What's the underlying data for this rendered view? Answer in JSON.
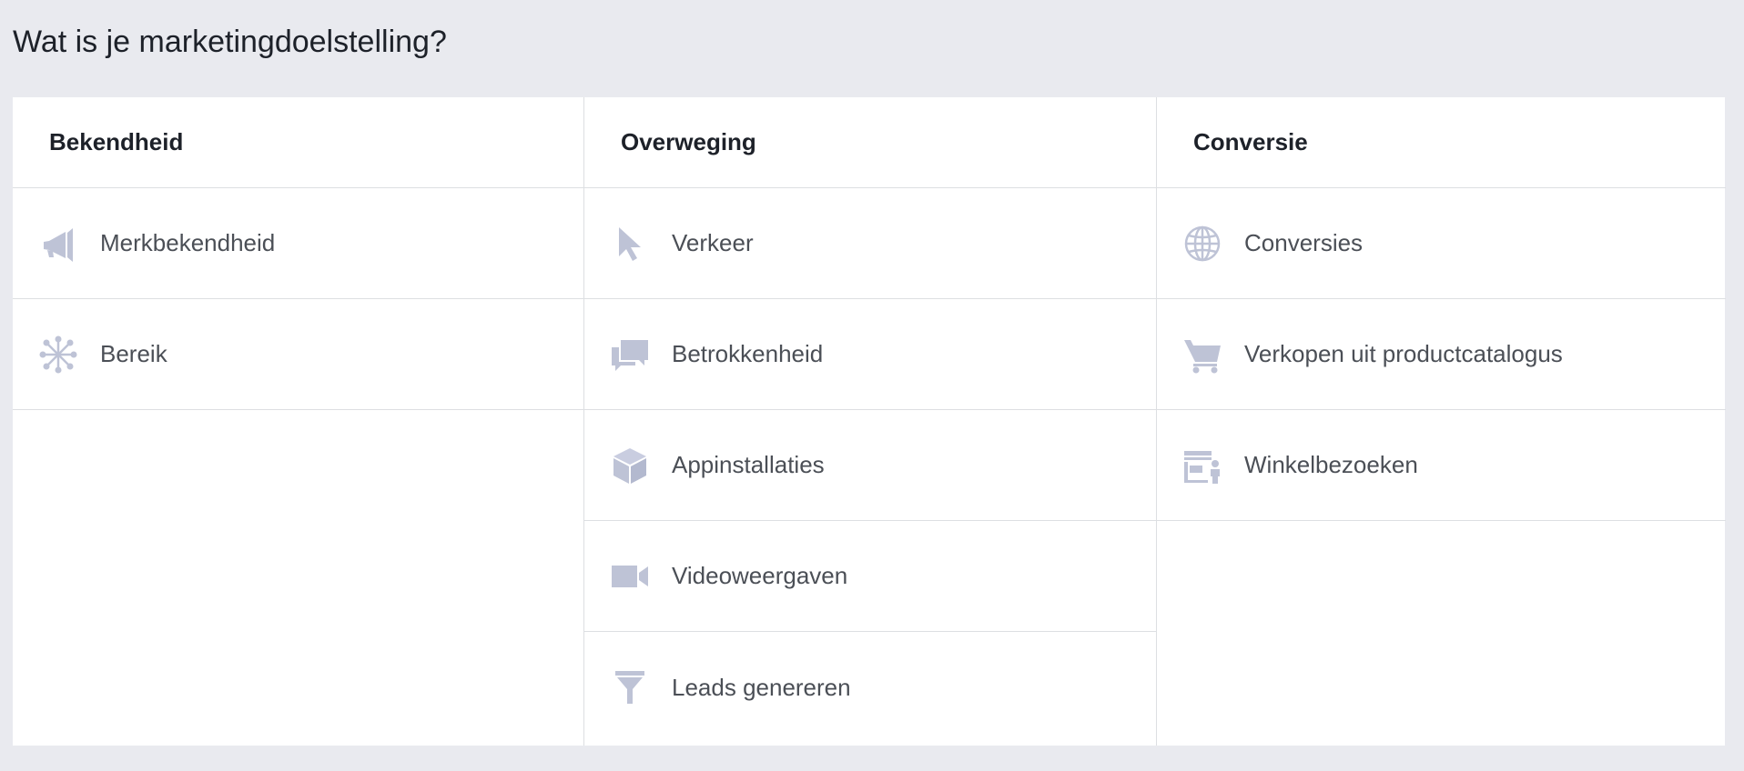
{
  "title": "Wat is je marketingdoelstelling?",
  "colors": {
    "background": "#e9eaef",
    "panel": "#ffffff",
    "divider": "#dddfe2",
    "icon": "#bec3d6",
    "text": "#4b4f56",
    "heading": "#1d2129"
  },
  "columns": [
    {
      "heading": "Bekendheid",
      "items": [
        {
          "label": "Merkbekendheid",
          "icon": "megaphone-icon"
        },
        {
          "label": "Bereik",
          "icon": "network-icon"
        }
      ]
    },
    {
      "heading": "Overweging",
      "items": [
        {
          "label": "Verkeer",
          "icon": "cursor-icon"
        },
        {
          "label": "Betrokkenheid",
          "icon": "chat-bubbles-icon"
        },
        {
          "label": "Appinstallaties",
          "icon": "box-icon"
        },
        {
          "label": "Videoweergaven",
          "icon": "video-camera-icon"
        },
        {
          "label": "Leads genereren",
          "icon": "funnel-icon"
        }
      ]
    },
    {
      "heading": "Conversie",
      "items": [
        {
          "label": "Conversies",
          "icon": "globe-icon"
        },
        {
          "label": "Verkopen uit productcatalogus",
          "icon": "shopping-cart-icon"
        },
        {
          "label": "Winkelbezoeken",
          "icon": "store-visit-icon"
        }
      ]
    }
  ]
}
